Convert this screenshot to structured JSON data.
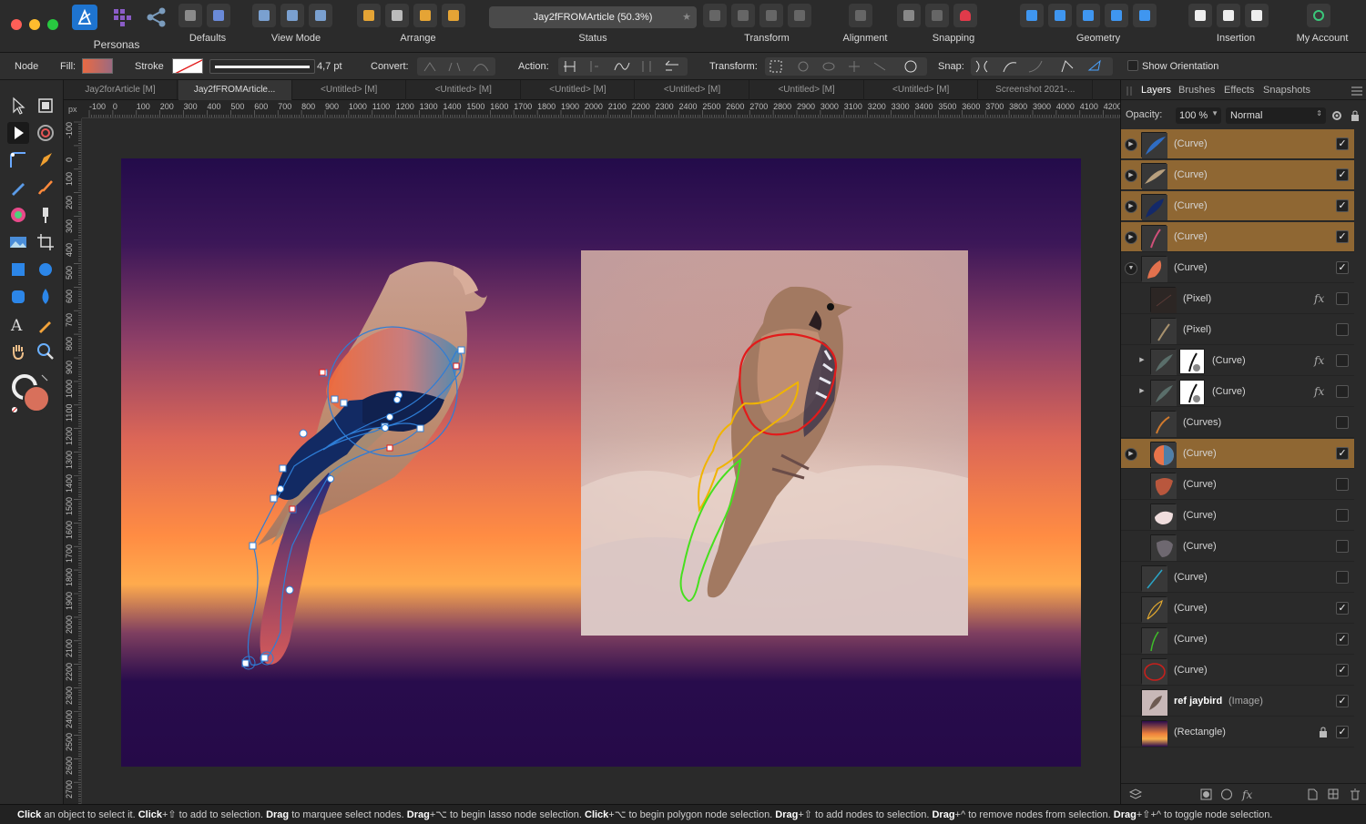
{
  "toolbar": {
    "personas_label": "Personas",
    "groups": [
      {
        "label": "Defaults",
        "icons": [
          "preview-icon",
          "quick-fill-icon"
        ]
      },
      {
        "label": "View Mode",
        "icons": [
          "view-mode-1-icon",
          "view-mode-2-icon",
          "view-mode-3-icon"
        ]
      },
      {
        "label": "Arrange",
        "icons": [
          "arrange-back-icon",
          "arrange-backward-icon",
          "arrange-forward-icon",
          "arrange-front-icon"
        ]
      },
      {
        "label": "Status",
        "icons": []
      },
      {
        "label": "Transform",
        "icons": [
          "flip-h-icon",
          "flip-v-icon",
          "rotate-left-icon",
          "rotate-right-icon"
        ]
      },
      {
        "label": "Alignment",
        "icons": [
          "align-icon"
        ]
      },
      {
        "label": "Snapping",
        "icons": [
          "grid-icon",
          "snap-arrow-icon",
          "magnet-icon"
        ]
      },
      {
        "label": "Geometry",
        "icons": [
          "add-icon",
          "subtract-icon",
          "intersect-icon",
          "xor-icon",
          "divide-icon"
        ]
      },
      {
        "label": "Insertion",
        "icons": [
          "insert-behind-icon",
          "insert-top-icon",
          "insert-inside-icon"
        ]
      },
      {
        "label": "My Account",
        "icons": [
          "account-icon"
        ]
      }
    ],
    "status_doc": "Jay2fFROMArticle (50.3%)",
    "status_star": "★"
  },
  "context": {
    "mode": "Node",
    "fill_label": "Fill:",
    "stroke_label": "Stroke",
    "stroke_width": "4,7 pt",
    "convert_label": "Convert:",
    "action_label": "Action:",
    "transform_label": "Transform:",
    "snap_label": "Snap:",
    "show_orientation": "Show Orientation"
  },
  "tabs": [
    "Jay2forArticle [M]",
    "Jay2fFROMArticle...",
    "<Untitled> [M]",
    "<Untitled> [M]",
    "<Untitled> [M]",
    "<Untitled> [M]",
    "<Untitled> [M]",
    "<Untitled> [M]",
    "Screenshot 2021-..."
  ],
  "ruler": {
    "unit": "px",
    "h_labels": [
      "-100",
      "0",
      "100",
      "200",
      "300",
      "400",
      "500",
      "600",
      "700",
      "800",
      "900",
      "1000",
      "1100",
      "1200",
      "1300",
      "1400",
      "1500",
      "1600",
      "1700",
      "1800",
      "1900",
      "2000",
      "2100",
      "2200",
      "2300",
      "2400",
      "2500",
      "2600",
      "2700",
      "2800",
      "2900",
      "3000",
      "3100",
      "3200",
      "3300",
      "3400",
      "3500",
      "3600",
      "3700",
      "3800",
      "3900",
      "4000",
      "4100",
      "4200"
    ],
    "v_labels": [
      "-100",
      "0",
      "100",
      "200",
      "300",
      "400",
      "500",
      "600",
      "700",
      "800",
      "900",
      "1000",
      "1100",
      "1200",
      "1300",
      "1400",
      "1500",
      "1600",
      "1700",
      "1800",
      "1900",
      "2000",
      "2100",
      "2200",
      "2300",
      "2400",
      "2500",
      "2600",
      "2700"
    ]
  },
  "panel": {
    "tabs": [
      "Layers",
      "Brushes",
      "Effects",
      "Snapshots"
    ],
    "opacity_label": "Opacity:",
    "opacity_value": "100 %",
    "blend_mode": "Normal",
    "layers": [
      {
        "name": "(Curve)",
        "type": "",
        "highlight": true,
        "checked": true,
        "indent": 0,
        "expander": "right",
        "fx": false,
        "thumb": "blue-feather"
      },
      {
        "name": "(Curve)",
        "type": "",
        "highlight": true,
        "checked": true,
        "indent": 0,
        "expander": "right",
        "fx": false,
        "thumb": "tan-feather"
      },
      {
        "name": "(Curve)",
        "type": "",
        "highlight": true,
        "checked": true,
        "indent": 0,
        "expander": "right",
        "fx": false,
        "thumb": "navy-feather"
      },
      {
        "name": "(Curve)",
        "type": "",
        "highlight": true,
        "checked": true,
        "indent": 0,
        "expander": "right",
        "fx": false,
        "thumb": "pink-line"
      },
      {
        "name": "(Curve)",
        "type": "",
        "highlight": false,
        "checked": true,
        "indent": 0,
        "expander": "down",
        "fx": false,
        "thumb": "orange-body"
      },
      {
        "name": "(Pixel)",
        "type": "",
        "highlight": false,
        "checked": false,
        "indent": 1,
        "expander": "",
        "fx": true,
        "thumb": "dark"
      },
      {
        "name": "(Pixel)",
        "type": "",
        "highlight": false,
        "checked": false,
        "indent": 1,
        "expander": "",
        "fx": false,
        "thumb": "tan-stroke"
      },
      {
        "name": "(Curve)",
        "type": "",
        "highlight": false,
        "checked": false,
        "indent": 1,
        "expander": "right-small",
        "fx": true,
        "thumb": "mask"
      },
      {
        "name": "(Curve)",
        "type": "",
        "highlight": false,
        "checked": false,
        "indent": 1,
        "expander": "right-small",
        "fx": true,
        "thumb": "mask"
      },
      {
        "name": "(Curves)",
        "type": "",
        "highlight": false,
        "checked": false,
        "indent": 1,
        "expander": "",
        "fx": false,
        "thumb": "orange-line"
      },
      {
        "name": "(Curve)",
        "type": "",
        "highlight": true,
        "checked": true,
        "indent": 1,
        "expander": "right",
        "fx": false,
        "thumb": "orange-circle"
      },
      {
        "name": "(Curve)",
        "type": "",
        "highlight": false,
        "checked": false,
        "indent": 1,
        "expander": "",
        "fx": false,
        "thumb": "rust-blob"
      },
      {
        "name": "(Curve)",
        "type": "",
        "highlight": false,
        "checked": false,
        "indent": 1,
        "expander": "",
        "fx": false,
        "thumb": "white-blob"
      },
      {
        "name": "(Curve)",
        "type": "",
        "highlight": false,
        "checked": false,
        "indent": 1,
        "expander": "",
        "fx": false,
        "thumb": "grey-blob"
      },
      {
        "name": "(Curve)",
        "type": "",
        "highlight": false,
        "checked": false,
        "indent": 0,
        "expander": "",
        "fx": false,
        "thumb": "cyan-line"
      },
      {
        "name": "(Curve)",
        "type": "",
        "highlight": false,
        "checked": true,
        "indent": 0,
        "expander": "",
        "fx": false,
        "thumb": "yellow-line"
      },
      {
        "name": "(Curve)",
        "type": "",
        "highlight": false,
        "checked": true,
        "indent": 0,
        "expander": "",
        "fx": false,
        "thumb": "green-line"
      },
      {
        "name": "(Curve)",
        "type": "",
        "highlight": false,
        "checked": true,
        "indent": 0,
        "expander": "",
        "fx": false,
        "thumb": "red-ring"
      },
      {
        "name": "ref jaybird",
        "type": "(Image)",
        "highlight": false,
        "checked": true,
        "indent": 0,
        "expander": "",
        "fx": false,
        "thumb": "photo",
        "bold": true
      },
      {
        "name": "(Rectangle)",
        "type": "",
        "highlight": false,
        "checked": true,
        "indent": 0,
        "expander": "",
        "fx": false,
        "thumb": "sunset",
        "locked": true
      }
    ]
  },
  "hint": [
    {
      "b": "Click",
      "t": " an object to select it. "
    },
    {
      "b": "Click",
      "t": "+⇧ to add to selection. "
    },
    {
      "b": "Drag",
      "t": " to marquee select nodes. "
    },
    {
      "b": "Drag",
      "t": "+⌥ to begin lasso node selection. "
    },
    {
      "b": "Click",
      "t": "+⌥ to begin polygon node selection. "
    },
    {
      "b": "Drag",
      "t": "+⇧ to add nodes to selection. "
    },
    {
      "b": "Drag",
      "t": "+^ to remove nodes from selection. "
    },
    {
      "b": "Drag",
      "t": "+⇧+^ to toggle node selection."
    }
  ],
  "colors": {
    "accent": "#1e74d0",
    "highlight": "#8f6733",
    "outline_red": "#e21b1b",
    "outline_yellow": "#f0b400",
    "outline_green": "#46e01e"
  }
}
